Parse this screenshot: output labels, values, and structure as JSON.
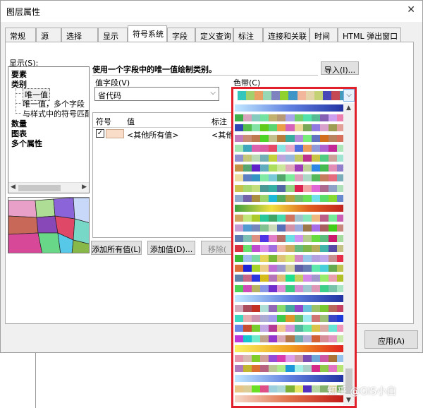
{
  "window": {
    "title": "图层属性"
  },
  "tabs": [
    "常规",
    "源",
    "选择",
    "显示",
    "符号系统",
    "字段",
    "定义查询",
    "标注",
    "连接和关联",
    "时间",
    "HTML 弹出窗口"
  ],
  "active_tab": "符号系统",
  "show": {
    "label": "显示(S):",
    "items": [
      "要素",
      "类别",
      "唯一值",
      "唯一值，多个字段",
      "与样式中的符号匹配",
      "数量",
      "图表",
      "多个属性"
    ]
  },
  "headline": "使用一个字段中的唯一值绘制类别。",
  "import_button": "导入(I)...",
  "value_field": {
    "label": "值字段(V)",
    "value": "省代码"
  },
  "color_ramp_label": "色带(C)",
  "grid": {
    "columns": [
      "符号",
      "值",
      "标注"
    ],
    "rows": [
      {
        "value": "<其他所有值>",
        "label": "<其他所"
      }
    ]
  },
  "buttons": {
    "add_all": "添加所有值(L)",
    "add_values": "添加值(D)...",
    "remove": "移除(",
    "apply": "应用(A)"
  },
  "watermark": "知乎 @GIS小白",
  "colors": {
    "ramp_border": "#e0202a",
    "selected_swatch": "#f9ddc9"
  },
  "icons": {
    "close": "close-icon",
    "dropdown": "chevron-down-icon"
  }
}
